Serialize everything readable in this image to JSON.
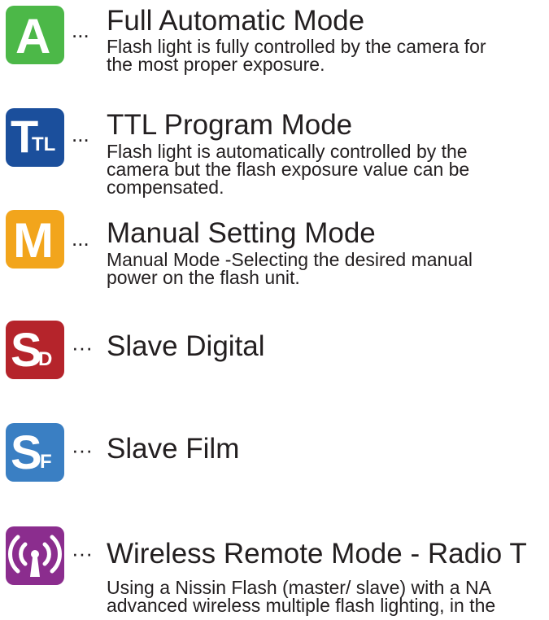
{
  "modes": [
    {
      "icon": "full-auto-a-icon",
      "icon_text": "A",
      "color": "#4cb848",
      "separator": "...",
      "title": "Full Automatic Mode",
      "desc_lines": [
        "Flash light is fully controlled by the camera for",
        "the most proper exposure."
      ]
    },
    {
      "icon": "ttl-icon",
      "icon_text": "T",
      "icon_sub": "TL",
      "color": "#1b4f9c",
      "separator": "...",
      "title": "TTL Program Mode",
      "desc_lines": [
        "Flash light is automatically controlled by the",
        "camera but the flash exposure value can be",
        "compensated."
      ]
    },
    {
      "icon": "manual-m-icon",
      "icon_text": "M",
      "color": "#f2a51c",
      "separator": "...",
      "title": "Manual Setting Mode",
      "desc_lines": [
        "Manual Mode -Selecting the desired manual",
        "power on the flash unit."
      ]
    },
    {
      "icon": "slave-digital-icon",
      "icon_text": "S",
      "icon_sub": "D",
      "color": "#b5242b",
      "separator": "···",
      "title": "Slave Digital"
    },
    {
      "icon": "slave-film-icon",
      "icon_text": "S",
      "icon_sub": "F",
      "color": "#3a7fc3",
      "separator": "···",
      "title": "Slave Film"
    },
    {
      "icon": "wireless-radio-icon",
      "color": "#8b2d8e",
      "separator": "···",
      "title": "Wireless Remote Mode - Radio T",
      "desc_lines": [
        "Using a Nissin Flash (master/ slave) with a NA",
        "advanced wireless multiple flash lighting, in the"
      ]
    }
  ]
}
